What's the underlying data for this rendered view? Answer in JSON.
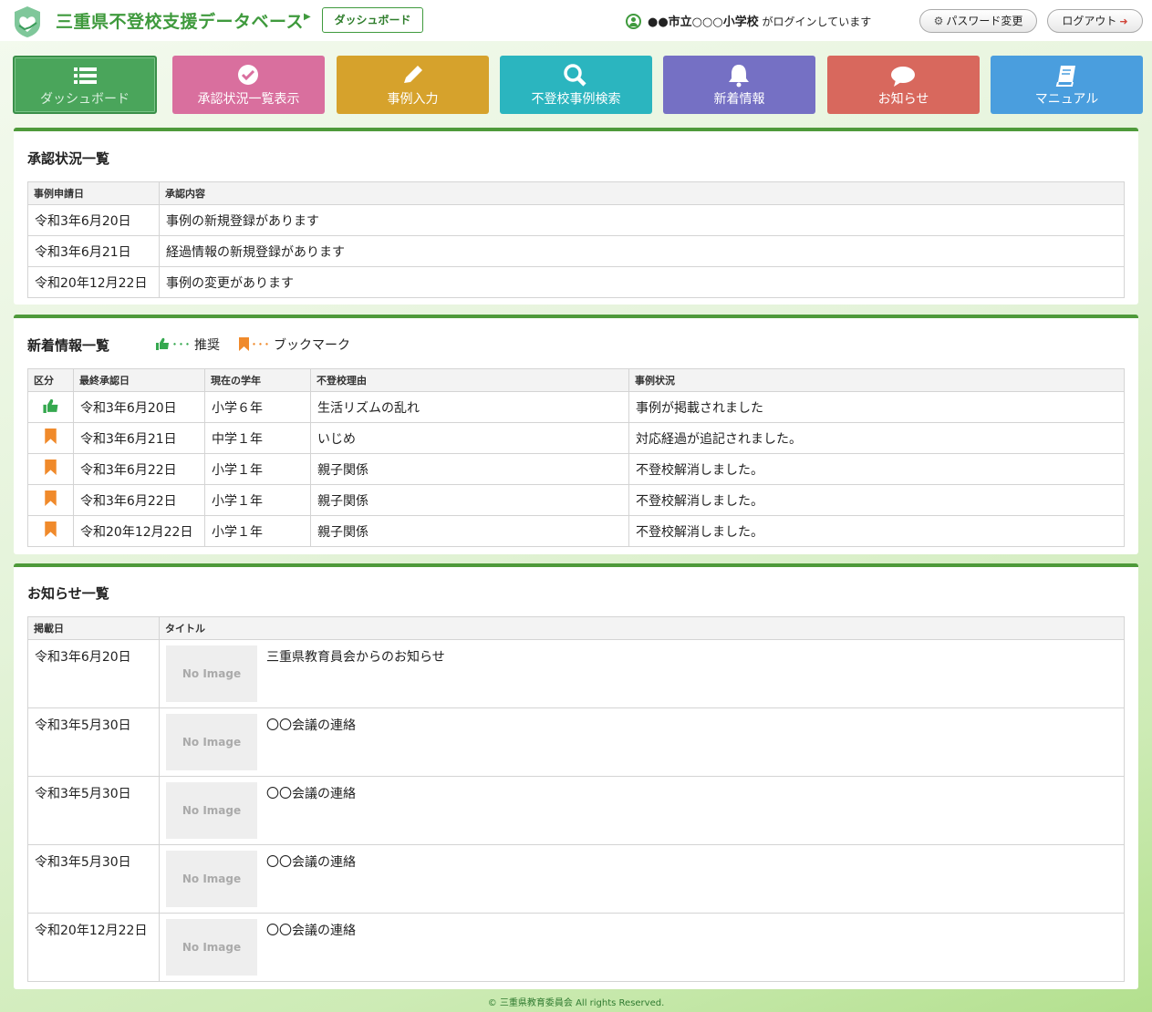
{
  "header": {
    "site_title": "三重県不登校支援データベース",
    "breadcrumb": "ダッシュボード",
    "login_school": "●●市立○○○小学校",
    "login_suffix": "がログインしています",
    "password_button": "パスワード変更",
    "logout_button": "ログアウト"
  },
  "nav": {
    "dashboard": "ダッシュボード",
    "approval_list": "承認状況一覧表示",
    "case_entry": "事例入力",
    "case_search": "不登校事例検索",
    "news": "新着情報",
    "notices": "お知らせ",
    "manual": "マニュアル",
    "colors": {
      "dashboard": "#4aa55b",
      "approval": "#d96f9e",
      "entry": "#d6a22c",
      "search": "#2bb5bf",
      "news": "#7570c4",
      "notice": "#d8685d",
      "manual": "#4a9ede"
    }
  },
  "approval": {
    "title": "承認状況一覧",
    "headers": [
      "事例申請日",
      "承認内容"
    ],
    "rows": [
      {
        "date": "令和3年6月20日",
        "content": "事例の新規登録があります"
      },
      {
        "date": "令和3年6月21日",
        "content": "経過情報の新規登録があります"
      },
      {
        "date": "令和20年12月22日",
        "content": "事例の変更があります"
      }
    ]
  },
  "news": {
    "title": "新着情報一覧",
    "legend_recommend_dots": "･･･",
    "legend_recommend": "推奨",
    "legend_bookmark_dots": "･･･",
    "legend_bookmark": "ブックマーク",
    "headers": [
      "区分",
      "最終承認日",
      "現在の学年",
      "不登校理由",
      "事例状況"
    ],
    "rows": [
      {
        "type": "thumbs-up-icon",
        "date": "令和3年6月20日",
        "grade": "小学６年",
        "reason": "生活リズムの乱れ",
        "status": "事例が掲載されました"
      },
      {
        "type": "bookmark-icon",
        "date": "令和3年6月21日",
        "grade": "中学１年",
        "reason": "いじめ",
        "status": "対応経過が追記されました。"
      },
      {
        "type": "bookmark-icon",
        "date": "令和3年6月22日",
        "grade": "小学１年",
        "reason": "親子関係",
        "status": "不登校解消しました。"
      },
      {
        "type": "bookmark-icon",
        "date": "令和3年6月22日",
        "grade": "小学１年",
        "reason": "親子関係",
        "status": "不登校解消しました。"
      },
      {
        "type": "bookmark-icon",
        "date": "令和20年12月22日",
        "grade": "小学１年",
        "reason": "親子関係",
        "status": "不登校解消しました。"
      }
    ]
  },
  "notices": {
    "title": "お知らせ一覧",
    "headers": [
      "掲載日",
      "タイトル"
    ],
    "no_image": "No Image",
    "rows": [
      {
        "date": "令和3年6月20日",
        "title": "三重県教育員会からのお知らせ"
      },
      {
        "date": "令和3年5月30日",
        "title": "〇〇会議の連絡"
      },
      {
        "date": "令和3年5月30日",
        "title": "〇〇会議の連絡"
      },
      {
        "date": "令和3年5月30日",
        "title": "〇〇会議の連絡"
      },
      {
        "date": "令和20年12月22日",
        "title": "〇〇会議の連絡"
      }
    ]
  },
  "footer": {
    "copyright": "© 三重県教育委員会 All rights Reserved."
  }
}
